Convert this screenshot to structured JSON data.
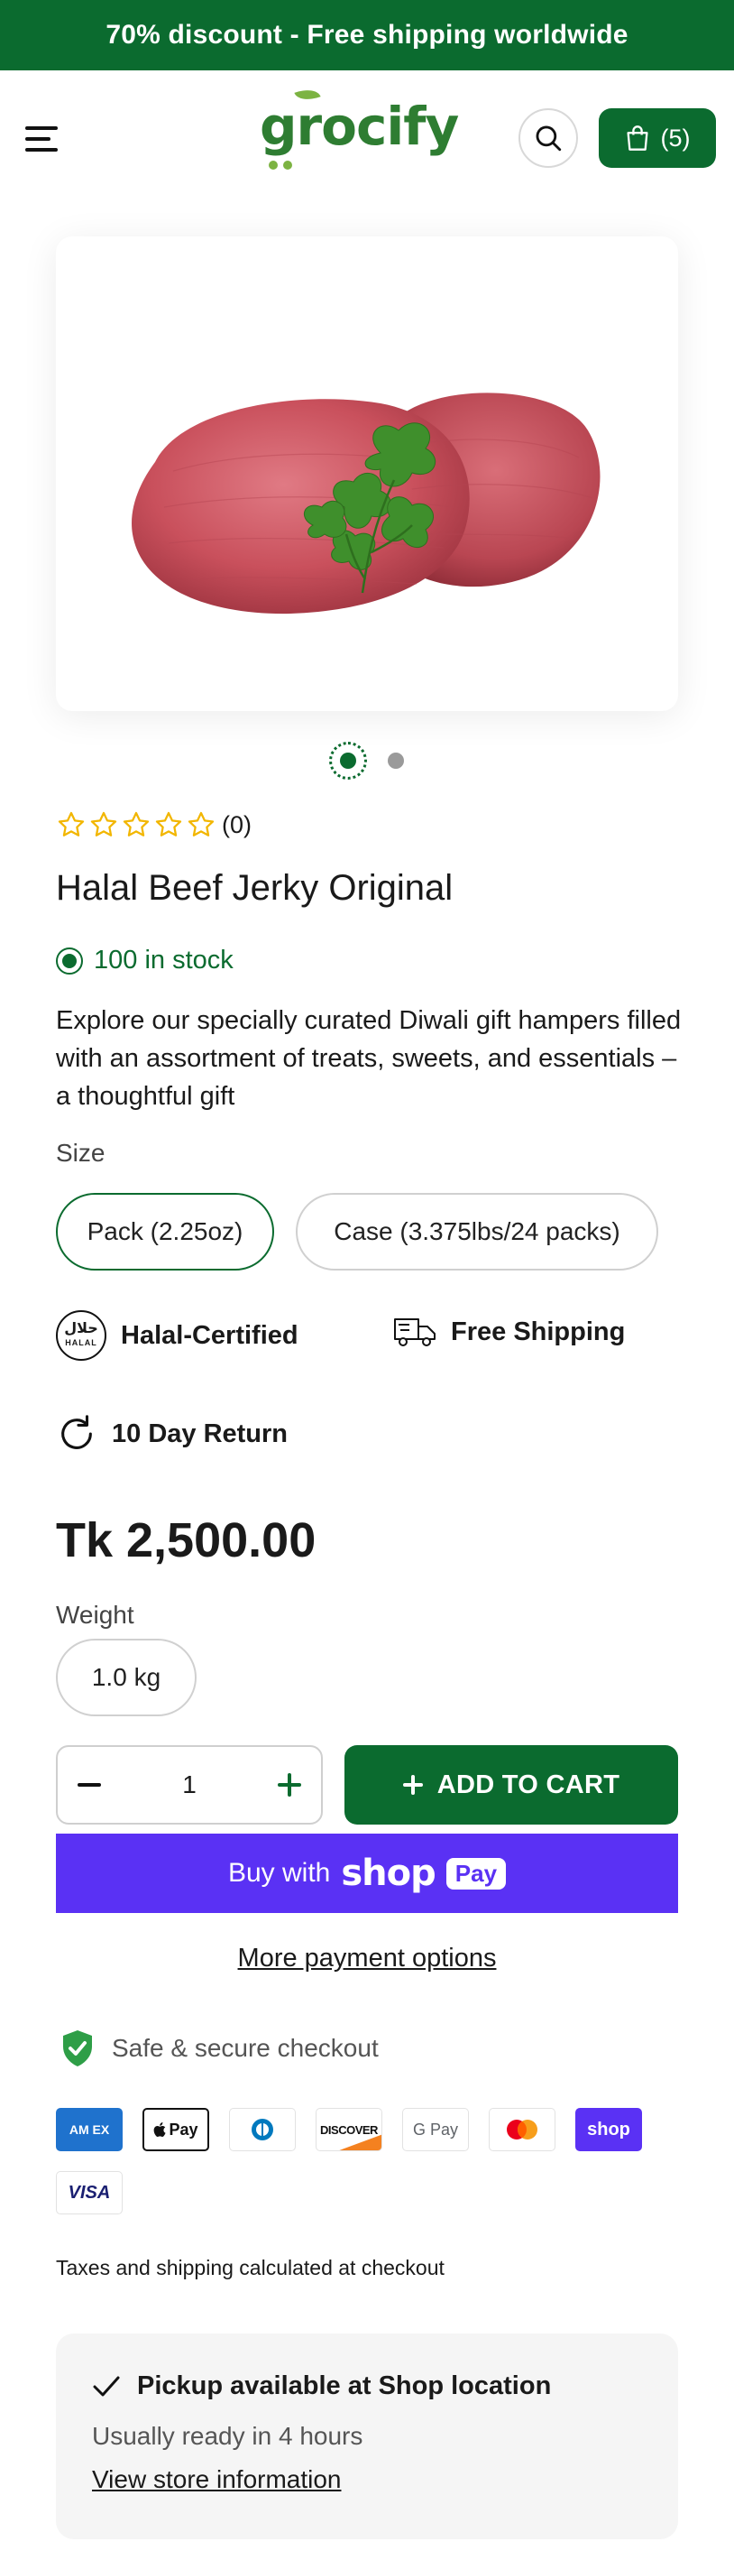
{
  "announcement": "70% discount - Free shipping worldwide",
  "header": {
    "logo": "grocify",
    "cart_count": "(5)"
  },
  "product": {
    "rating_count": "(0)",
    "rating_value": "0 of 5 stars",
    "title": "Halal Beef Jerky Original",
    "stock": "100 in stock",
    "description": "Explore our specially curated Diwali gift hampers filled with an assortment of treats, sweets, and essentials – a thoughtful gift",
    "size_label": "Size",
    "sizes": [
      {
        "label": "Pack (2.25oz)",
        "selected": true
      },
      {
        "label": "Case (3.375lbs/24 packs)",
        "selected": false
      }
    ],
    "features": {
      "halal": "Halal-Certified",
      "shipping": "Free Shipping",
      "return": "10 Day Return",
      "halal_badge_text": "حلال HALAL"
    },
    "price": "Tk 2,500.00",
    "weight_label": "Weight",
    "weight": "1.0 kg",
    "quantity": "1",
    "add_to_cart": "ADD TO CART",
    "gallery": {
      "current": 1,
      "total": 2
    }
  },
  "checkout": {
    "buy_with": "Buy with",
    "shop_word": "shop",
    "pay_word": "Pay",
    "more_options": "More payment options",
    "secure": "Safe & secure checkout",
    "payment_methods": [
      "AMEX",
      "Apple Pay",
      "Diners Club",
      "DISCOVER",
      "G Pay",
      "Mastercard",
      "shop",
      "VISA"
    ],
    "payment_labels": {
      "amex": "AM EX",
      "apple": "Pay",
      "discover": "DISCOVER",
      "gpay": "G Pay",
      "shop": "shop",
      "visa": "VISA"
    },
    "taxes": "Taxes and shipping calculated at checkout"
  },
  "pickup": {
    "title": "Pickup available at Shop location",
    "ready": "Usually ready in 4 hours",
    "link": "View store information"
  },
  "colors": {
    "brand_green": "#0b6b2f",
    "shop_pay_purple": "#5a31f4",
    "star_yellow": "#f2b600"
  },
  "icons": [
    "menu-icon",
    "search-icon",
    "bag-icon",
    "star-icon",
    "halal-icon",
    "truck-icon",
    "return-icon",
    "plus-icon",
    "minus-icon",
    "shield-check-icon",
    "check-icon"
  ]
}
